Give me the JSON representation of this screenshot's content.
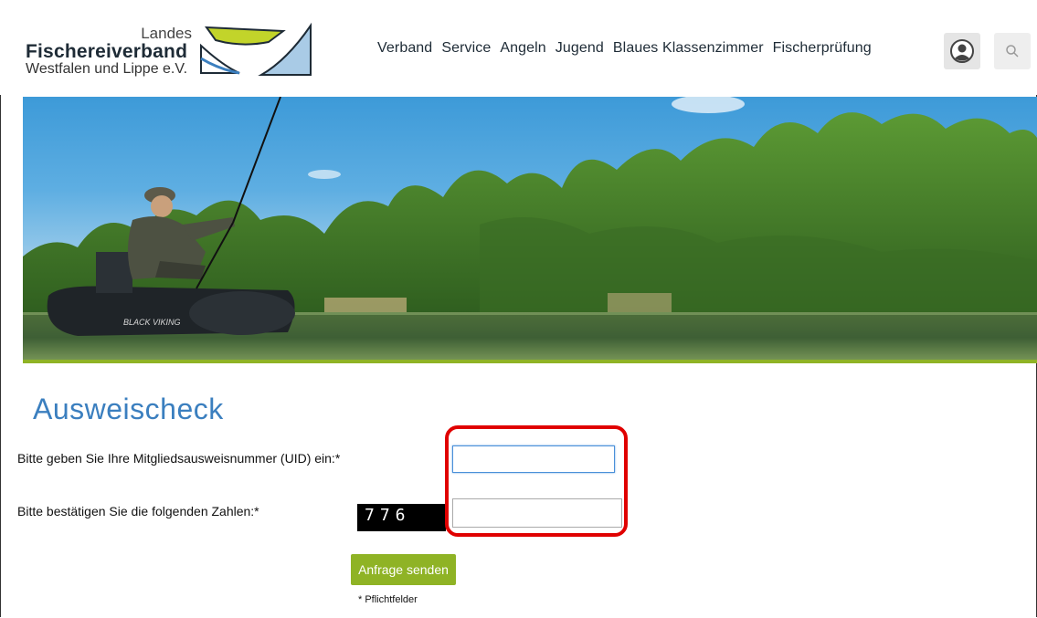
{
  "header": {
    "logo": {
      "line1": "Landes",
      "line2": "Fischereiverband",
      "line3": "Westfalen und Lippe e.V."
    },
    "nav": [
      "Verband",
      "Service",
      "Angeln",
      "Jugend",
      "Blaues Klassenzimmer",
      "Fischerprüfung"
    ],
    "icons": {
      "user": "user-account-icon",
      "search": "search-icon"
    }
  },
  "hero": {
    "boat_text": "BLACK VIKING"
  },
  "form": {
    "title": "Ausweischeck",
    "uid_label": "Bitte geben Sie Ihre Mitgliedsausweisnummer (UID) ein:*",
    "uid_value": "",
    "captcha_label": "Bitte bestätigen Sie die folgenden Zahlen:*",
    "captcha_code": "776",
    "captcha_value": "",
    "submit_label": "Anfrage senden",
    "required_note": "* Pflichtfelder"
  },
  "colors": {
    "accent_green": "#8fb325",
    "title_blue": "#3b7fbf",
    "highlight_red": "#e00000",
    "nav_text": "#1e2b36"
  }
}
